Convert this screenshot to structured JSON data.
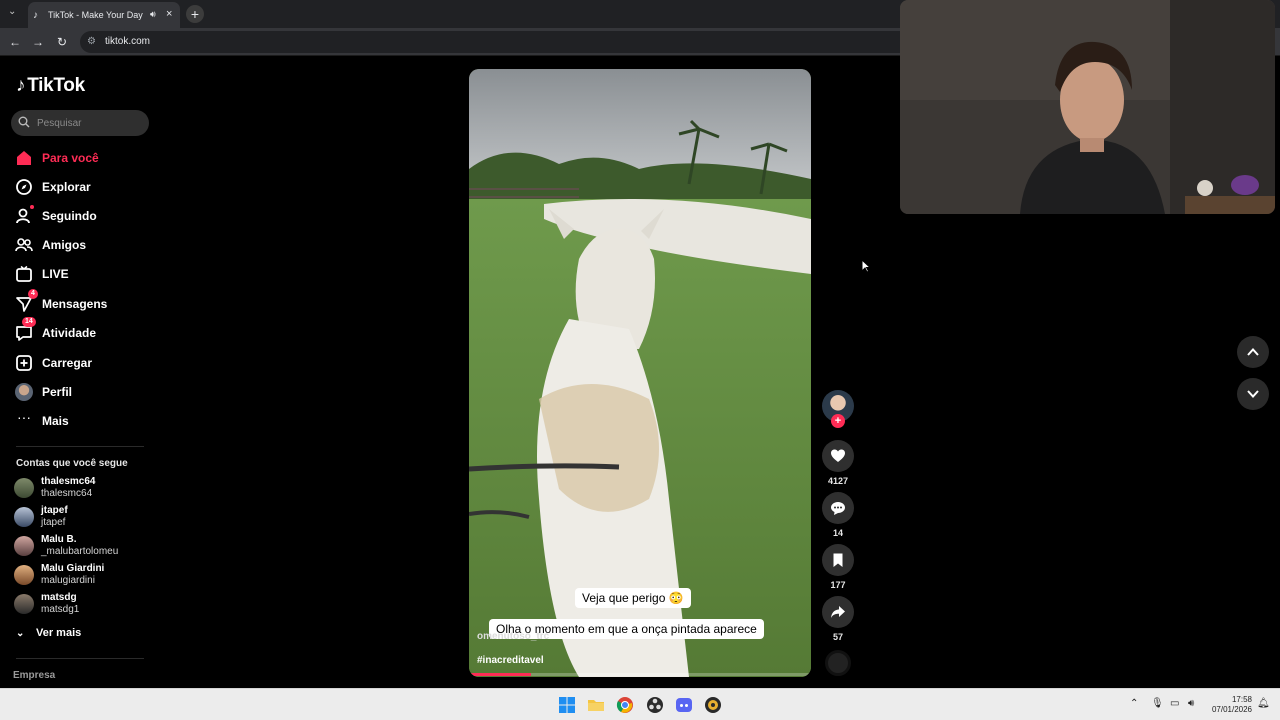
{
  "browser": {
    "tab_title": "TikTok - Make Your Day",
    "url": "tiktok.com"
  },
  "sidebar": {
    "logo": "TikTok",
    "search_placeholder": "Pesquisar",
    "nav": [
      {
        "label": "Para você",
        "icon": "home-icon",
        "active": true
      },
      {
        "label": "Explorar",
        "icon": "compass-icon"
      },
      {
        "label": "Seguindo",
        "icon": "following-icon"
      },
      {
        "label": "Amigos",
        "icon": "friends-icon"
      },
      {
        "label": "LIVE",
        "icon": "live-icon"
      },
      {
        "label": "Mensagens",
        "icon": "messages-icon",
        "badge": "4"
      },
      {
        "label": "Atividade",
        "icon": "activity-icon",
        "badge": "14"
      },
      {
        "label": "Carregar",
        "icon": "upload-icon"
      },
      {
        "label": "Perfil",
        "icon": "profile-avatar"
      },
      {
        "label": "Mais",
        "icon": "more-icon"
      }
    ],
    "following_title": "Contas que você segue",
    "following": [
      {
        "name": "thalesmc64",
        "handle": "thalesmc64"
      },
      {
        "name": "jtapef",
        "handle": "jtapef"
      },
      {
        "name": "Malu B.",
        "handle": "_malubartolomeu"
      },
      {
        "name": "Malu Giardini",
        "handle": "malugiardini"
      },
      {
        "name": "matsdg",
        "handle": "matsdg1"
      }
    ],
    "see_more": "Ver mais",
    "footer": "Empresa"
  },
  "video": {
    "caption_top": "Veja que perigo 😳",
    "caption_bottom": "Olha o momento em que a onça pintada aparece",
    "username": "omenutoso_trc",
    "hashtag": "#inacreditavel",
    "progress": 0.18
  },
  "actions": {
    "likes": "4127",
    "comments": "14",
    "saves": "177",
    "shares": "57"
  },
  "taskbar": {
    "time": "17:58",
    "date": "07/01/2026"
  }
}
